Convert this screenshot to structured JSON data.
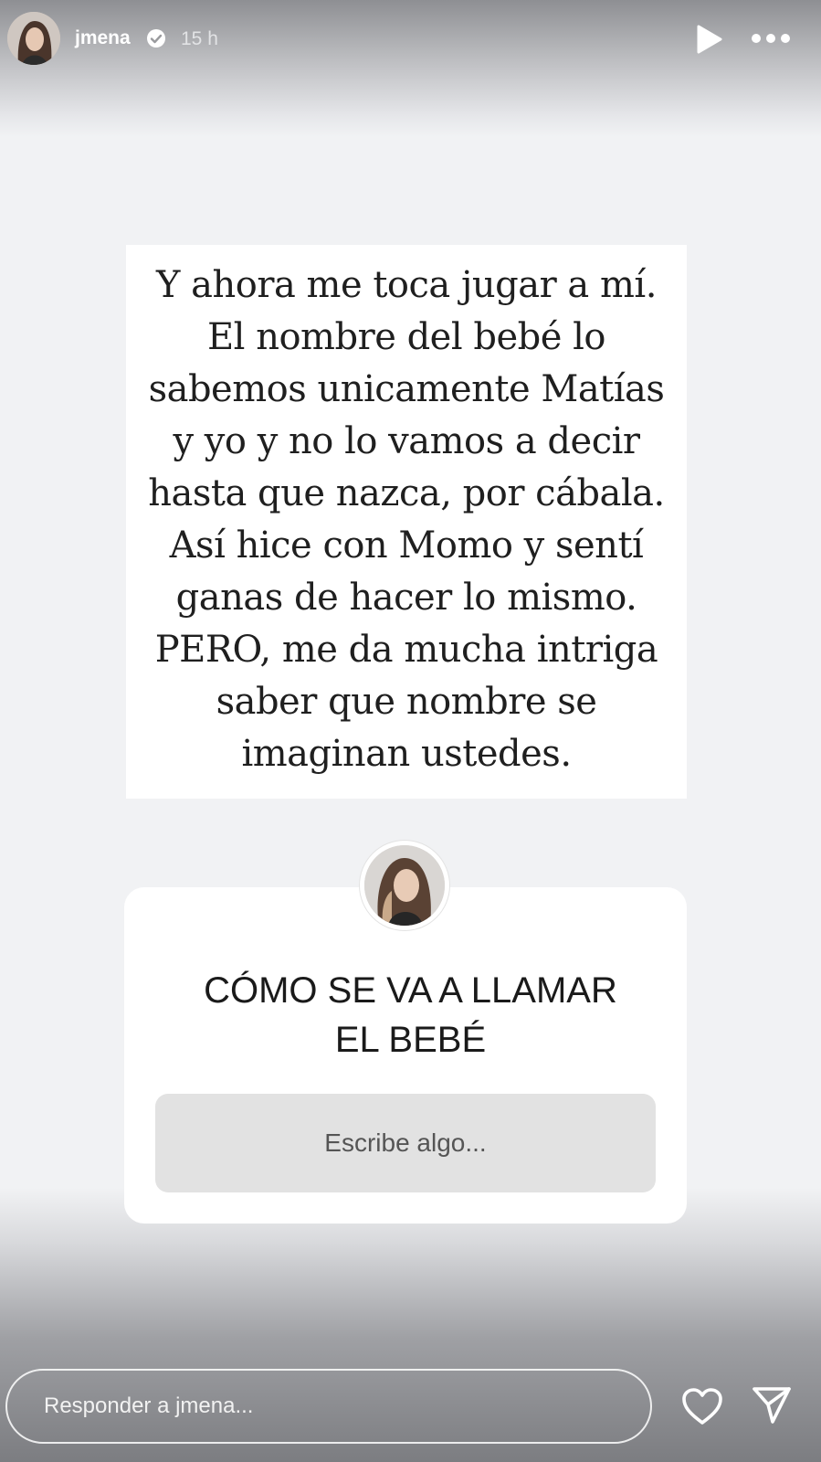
{
  "header": {
    "username": "jmena",
    "time": "15 h"
  },
  "story": {
    "lines": [
      "Y ahora me toca jugar a mí.",
      "El nombre del bebé lo",
      "sabemos unicamente Matías",
      "y yo y no lo vamos a decir",
      "hasta que nazca, por cábala.",
      "Así hice con Momo y sentí",
      "ganas de hacer lo mismo.",
      "PERO, me da mucha intriga",
      "saber que nombre se",
      "imaginan ustedes."
    ]
  },
  "question": {
    "title_line1": "CÓMO SE VA A LLAMAR",
    "title_line2": "EL BEBÉ",
    "input_placeholder": "Escribe algo..."
  },
  "footer": {
    "reply_placeholder": "Responder a jmena..."
  },
  "icons": {
    "verified": "verified-badge-icon",
    "play": "play-icon",
    "more": "more-options-icon",
    "heart": "heart-icon",
    "send": "send-icon"
  },
  "colors": {
    "card_bg": "#ffffff",
    "story_bg": "#f1f2f4",
    "input_bg": "#e2e2e2"
  }
}
